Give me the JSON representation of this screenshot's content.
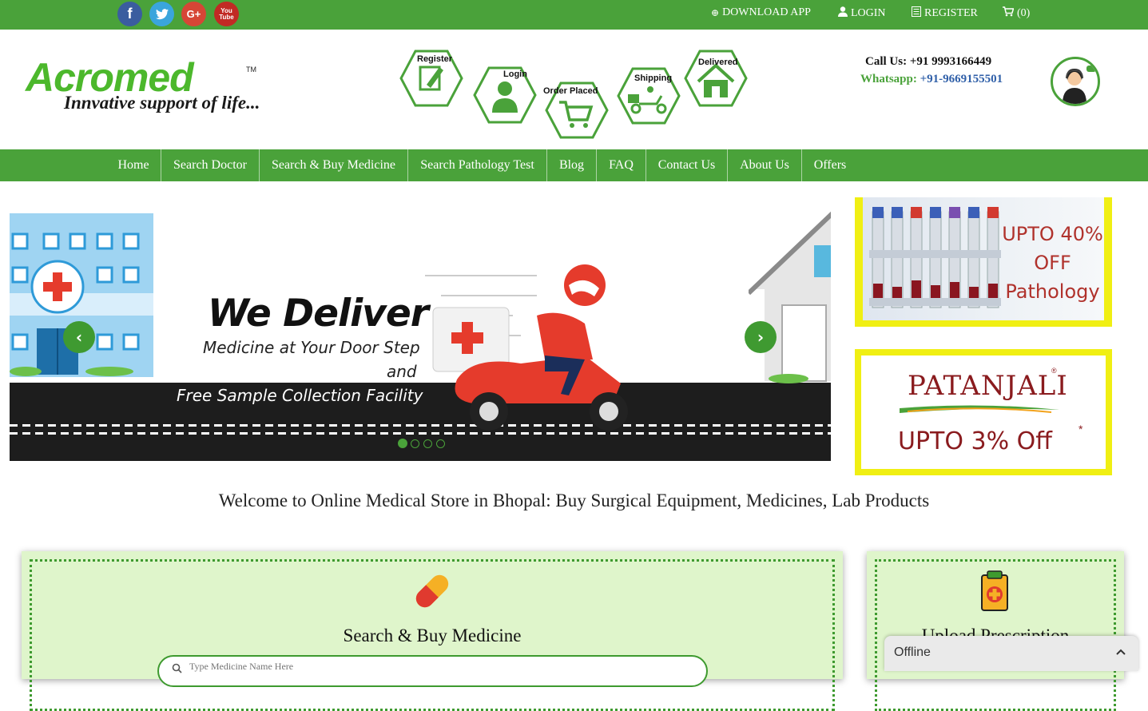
{
  "topbar": {
    "social": [
      {
        "name": "facebook-icon",
        "glyph": "f"
      },
      {
        "name": "twitter-icon",
        "glyph": "t"
      },
      {
        "name": "google-plus-icon",
        "glyph": "G+"
      },
      {
        "name": "youtube-icon",
        "glyph": "You Tube"
      }
    ],
    "download_app": "DOWNLOAD APP",
    "login": "LOGIN",
    "register": "REGISTER",
    "cart": "(0)"
  },
  "header": {
    "logo_text": "Acromed",
    "logo_tm": "TM",
    "tagline": "Innvative support of life...",
    "steps": [
      "Register",
      "Login",
      "Order Placed",
      "Shipping",
      "Delivered"
    ],
    "call_label": "Call Us: ",
    "call_number": "+91 9993166449",
    "whatsapp_label": "Whatsapp: ",
    "whatsapp_number": "+91-9669155501"
  },
  "nav": [
    "Home",
    "Search Doctor",
    "Search & Buy Medicine",
    "Search Pathology Test",
    "Blog",
    "FAQ",
    "Contact Us",
    "About Us",
    "Offers"
  ],
  "slider": {
    "heading": "We Deliver",
    "line1": "Medicine at Your Door Step",
    "line2": "and",
    "line3": "Free Sample Collection Facility",
    "prev": "‹",
    "next": "›",
    "dots": 4,
    "active_dot": 0
  },
  "banners": {
    "pathology_line1": "UPTO 40%",
    "pathology_line2": "OFF",
    "pathology_line3": "Pathology",
    "patanjali_brand": "PATANJALI",
    "patanjali_reg": "®",
    "patanjali_offer": "UPTO 3% Off",
    "patanjali_star": "*"
  },
  "welcome": "Welcome to Online Medical Store in Bhopal: Buy Surgical Equipment, Medicines, Lab Products",
  "search": {
    "title": "Search & Buy Medicine",
    "placeholder": "Type Medicine Name Here"
  },
  "upload": {
    "title": "Upload Prescription"
  },
  "chat": {
    "status": "Offline"
  },
  "colors": {
    "brand_green": "#4aa23a",
    "card_bg": "#dff5cb",
    "banner_yellow": "#f0ef13"
  }
}
